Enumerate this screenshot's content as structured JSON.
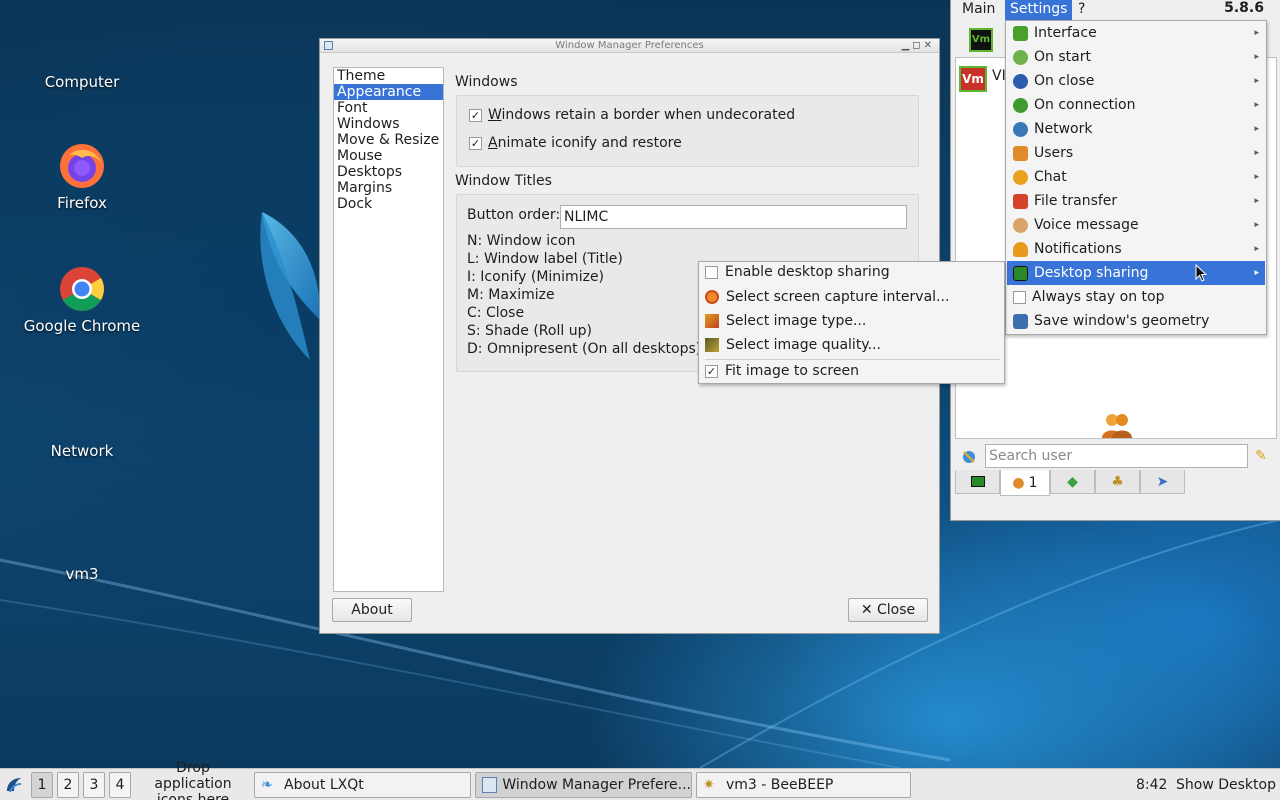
{
  "desktop": {
    "icons": [
      {
        "label": "Computer",
        "icon": "computer-icon"
      },
      {
        "label": "Firefox",
        "icon": "firefox-icon"
      },
      {
        "label": "Google Chrome",
        "icon": "chrome-icon"
      },
      {
        "label": "Network",
        "icon": "network-icon"
      },
      {
        "label": "vm3",
        "icon": "folder-icon"
      }
    ]
  },
  "wm_prefs": {
    "title": "Window Manager Preferences",
    "categories": [
      "Theme",
      "Appearance",
      "Font",
      "Windows",
      "Move & Resize",
      "Mouse",
      "Desktops",
      "Margins",
      "Dock"
    ],
    "selected_category": "Appearance",
    "windows_group": {
      "title": "Windows",
      "retain_border_prefix": "W",
      "retain_border_rest": "indows retain a border when undecorated",
      "retain_border_checked": true,
      "animate_prefix": "A",
      "animate_rest": "nimate iconify and restore",
      "animate_checked": true
    },
    "titles_group": {
      "title": "Window Titles",
      "button_order_label": "Button order:",
      "button_order_value": "NLIMC",
      "legend": [
        "N: Window icon",
        "L: Window label (Title)",
        "I: Iconify (Minimize)",
        "M: Maximize",
        "C: Close",
        "S: Shade (Roll up)",
        "D: Omnipresent (On all desktops)"
      ]
    },
    "about_label": "About",
    "close_label": "Close"
  },
  "desktop_sharing_submenu": {
    "items": [
      {
        "label": "Enable desktop sharing",
        "icon": "checkbox-icon",
        "checked": false
      },
      {
        "label": "Select screen capture interval...",
        "icon": "timer-icon"
      },
      {
        "label": "Select image type...",
        "icon": "image-type-icon"
      },
      {
        "label": "Select image quality...",
        "icon": "image-quality-icon"
      },
      {
        "label": "Fit image to screen",
        "icon": "checkbox-icon",
        "checked": true
      }
    ]
  },
  "beebeep": {
    "menubar": {
      "main": "Main",
      "settings": "Settings",
      "help": "?"
    },
    "version": "5.8.6",
    "vm_badge": "Vm",
    "vm_partial": "VI",
    "search_placeholder": "Search user",
    "tabs": [
      {
        "icon": "computer-green-icon",
        "label": ""
      },
      {
        "icon": "users-icon",
        "label": "1"
      },
      {
        "icon": "chat-icon",
        "label": ""
      },
      {
        "icon": "groups-icon",
        "label": ""
      },
      {
        "icon": "pin-icon",
        "label": ""
      }
    ],
    "settings_menu": [
      {
        "label": "Interface",
        "icon": "interface-icon",
        "color": "#4aa02c",
        "submenu": true
      },
      {
        "label": "On start",
        "icon": "on-start-icon",
        "color": "#6fb24a",
        "submenu": true
      },
      {
        "label": "On close",
        "icon": "on-close-icon",
        "color": "#2c5db0",
        "submenu": true
      },
      {
        "label": "On connection",
        "icon": "on-connection-icon",
        "color": "#3f9a2f",
        "submenu": true
      },
      {
        "label": "Network",
        "icon": "network-icon",
        "color": "#3a78b6",
        "submenu": true
      },
      {
        "label": "Users",
        "icon": "users-icon",
        "color": "#e08a2a",
        "submenu": true
      },
      {
        "label": "Chat",
        "icon": "chat-icon",
        "color": "#e7a21f",
        "submenu": true
      },
      {
        "label": "File transfer",
        "icon": "file-transfer-icon",
        "color": "#d4422a",
        "submenu": true
      },
      {
        "label": "Voice message",
        "icon": "voice-message-icon",
        "color": "#d9a36a",
        "submenu": true
      },
      {
        "label": "Notifications",
        "icon": "bell-icon",
        "color": "#e89a1c",
        "submenu": true
      },
      {
        "label": "Desktop sharing",
        "icon": "desktop-sharing-icon",
        "color": "#2a8a2a",
        "submenu": true,
        "highlighted": true
      },
      {
        "label": "Always stay on top",
        "icon": "checkbox-icon",
        "color": "#ffffff",
        "submenu": false
      },
      {
        "label": "Save window's geometry",
        "icon": "save-geometry-icon",
        "color": "#3c6fb0",
        "submenu": false
      }
    ]
  },
  "taskbar": {
    "desktops": [
      "1",
      "2",
      "3",
      "4"
    ],
    "active_desktop": "1",
    "drop_hint_1": "Drop application",
    "drop_hint_2": "icons here",
    "tasks": [
      {
        "label": "About LXQt",
        "icon": "lxqt-icon"
      },
      {
        "label": "Window Manager Prefere...",
        "icon": "window-icon"
      },
      {
        "label": "vm3 - BeeBEEP",
        "icon": "bee-icon"
      }
    ],
    "clock": "8:42",
    "show_desktop": "Show Desktop"
  }
}
